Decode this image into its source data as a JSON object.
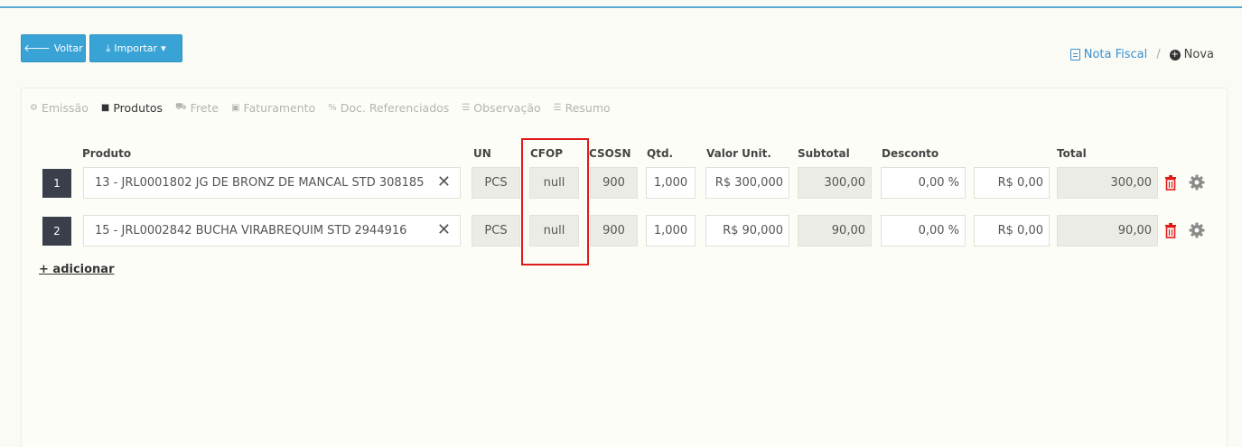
{
  "toolbar": {
    "back_label": "Voltar",
    "import_label": "Importar",
    "import_caret": "▾",
    "back_icon": "arrow-left-icon",
    "import_icon": "download-icon"
  },
  "breadcrumb": {
    "parent": "Nota Fiscal",
    "separator": "/",
    "current": "Nova"
  },
  "tabs": [
    {
      "label": "Emissão",
      "icon": "gear-icon"
    },
    {
      "label": "Produtos",
      "icon": "box-icon"
    },
    {
      "label": "Frete",
      "icon": "truck-icon"
    },
    {
      "label": "Faturamento",
      "icon": "money-icon"
    },
    {
      "label": "Doc. Referenciados",
      "icon": "link-icon"
    },
    {
      "label": "Observação",
      "icon": "list-icon"
    },
    {
      "label": "Resumo",
      "icon": "list-icon"
    }
  ],
  "table": {
    "headers": {
      "produto": "Produto",
      "un": "UN",
      "cfop": "CFOP",
      "csosn": "CSOSN",
      "qtd": "Qtd.",
      "valor_unit": "Valor Unit.",
      "subtotal": "Subtotal",
      "desconto": "Desconto",
      "total": "Total"
    },
    "rows": [
      {
        "num": "1",
        "produto": "13 - JRL0001802 JG DE BRONZ DE MANCAL STD 308185",
        "un": "PCS",
        "cfop": "null",
        "csosn": "900",
        "qtd": "1,000",
        "valor_unit": "R$ 300,000",
        "subtotal": "300,00",
        "desconto_pct": "0,00 %",
        "desconto_val": "R$ 0,00",
        "total": "300,00"
      },
      {
        "num": "2",
        "produto": "15 - JRL0002842 BUCHA VIRABREQUIM STD 2944916",
        "un": "PCS",
        "cfop": "null",
        "csosn": "900",
        "qtd": "1,000",
        "valor_unit": "R$ 90,000",
        "subtotal": "90,00",
        "desconto_pct": "0,00 %",
        "desconto_val": "R$ 0,00",
        "total": "90,00"
      }
    ],
    "clear_glyph": "✕"
  },
  "add_label": "+ adicionar",
  "colors": {
    "accent": "#3aa3d6",
    "danger": "#e01a1a",
    "row_badge": "#3a3f4b"
  }
}
